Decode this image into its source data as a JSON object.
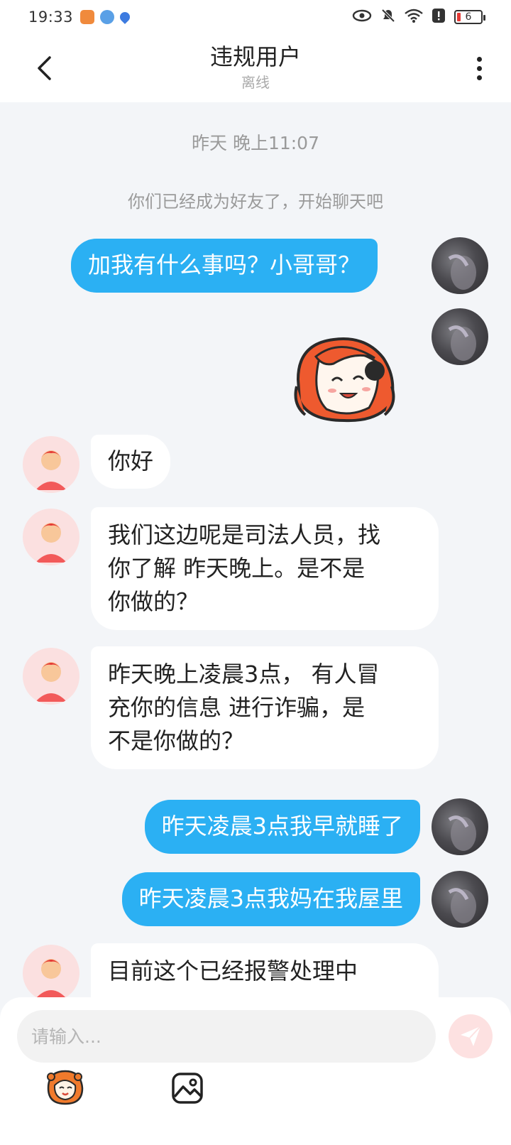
{
  "status_bar": {
    "time": "19:33",
    "battery": "6",
    "icons": [
      "app-notification-icon",
      "weather-icon",
      "location-icon",
      "eye-icon",
      "mute-icon",
      "wifi-icon",
      "alert-icon",
      "battery-icon"
    ]
  },
  "header": {
    "title": "违规用户",
    "status": "离线",
    "back_icon": "chevron-left-icon",
    "more_icon": "more-vertical-icon"
  },
  "chat": {
    "timestamp": "昨天 晚上11:07",
    "system_note": "你们已经成为好友了，开始聊天吧",
    "messages": [
      {
        "side": "out",
        "type": "text",
        "text": "加我有什么事吗？小哥哥？"
      },
      {
        "side": "out",
        "type": "sticker",
        "description": "cartoon-girl-sticker"
      },
      {
        "side": "in",
        "type": "text",
        "text": "你好"
      },
      {
        "side": "in",
        "type": "text",
        "text": "我们这边呢是司法人员，找\n你了解 昨天晚上。是不是\n你做的？"
      },
      {
        "side": "in",
        "type": "text",
        "text": "昨天晚上凌晨3点， 有人冒\n充你的信息 进行诈骗，是\n不是你做的？"
      },
      {
        "side": "out",
        "type": "text",
        "text": "昨天凌晨3点我早就睡了"
      },
      {
        "side": "out",
        "type": "text",
        "text": "昨天凌晨3点我妈在我屋里"
      },
      {
        "side": "in",
        "type": "text",
        "text": "目前这个已经报警处理中"
      }
    ]
  },
  "input": {
    "placeholder": "请输入...",
    "send_icon": "send-icon",
    "toolbar": [
      "emoji-sticker-icon",
      "image-icon"
    ]
  },
  "colors": {
    "outgoing_bubble": "#2bb0f3",
    "incoming_bubble": "#ffffff",
    "background": "#f3f5f8",
    "send_button": "#fde1e1"
  }
}
